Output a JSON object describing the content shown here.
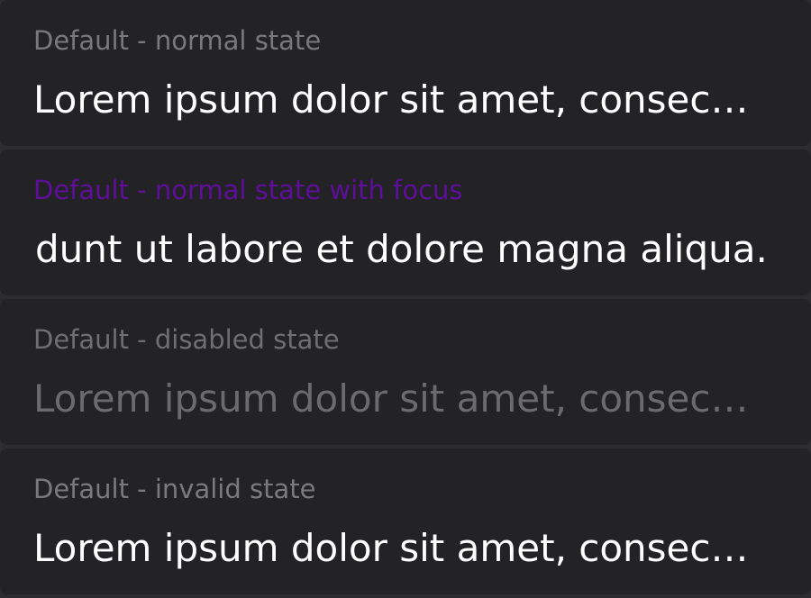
{
  "fields": [
    {
      "label": "Default - normal state",
      "value": "Lorem ipsum dolor sit amet, consec…",
      "state": "normal"
    },
    {
      "label": "Default - normal state with focus",
      "value": "dunt ut labore et dolore magna aliqua.",
      "state": "focused",
      "label_color": "#5e0e9a"
    },
    {
      "label": "Default - disabled state",
      "value": "Lorem ipsum dolor sit amet, consec…",
      "state": "disabled"
    },
    {
      "label": "Default - invalid state",
      "value": "Lorem ipsum dolor sit amet, consec…",
      "state": "invalid"
    }
  ],
  "colors": {
    "background": "#2d2d30",
    "field_background": "#232325",
    "label": "#79797d",
    "focus_label": "#5e0e9a",
    "value_text": "#ffffff",
    "disabled_text": "#6b6b6f"
  }
}
